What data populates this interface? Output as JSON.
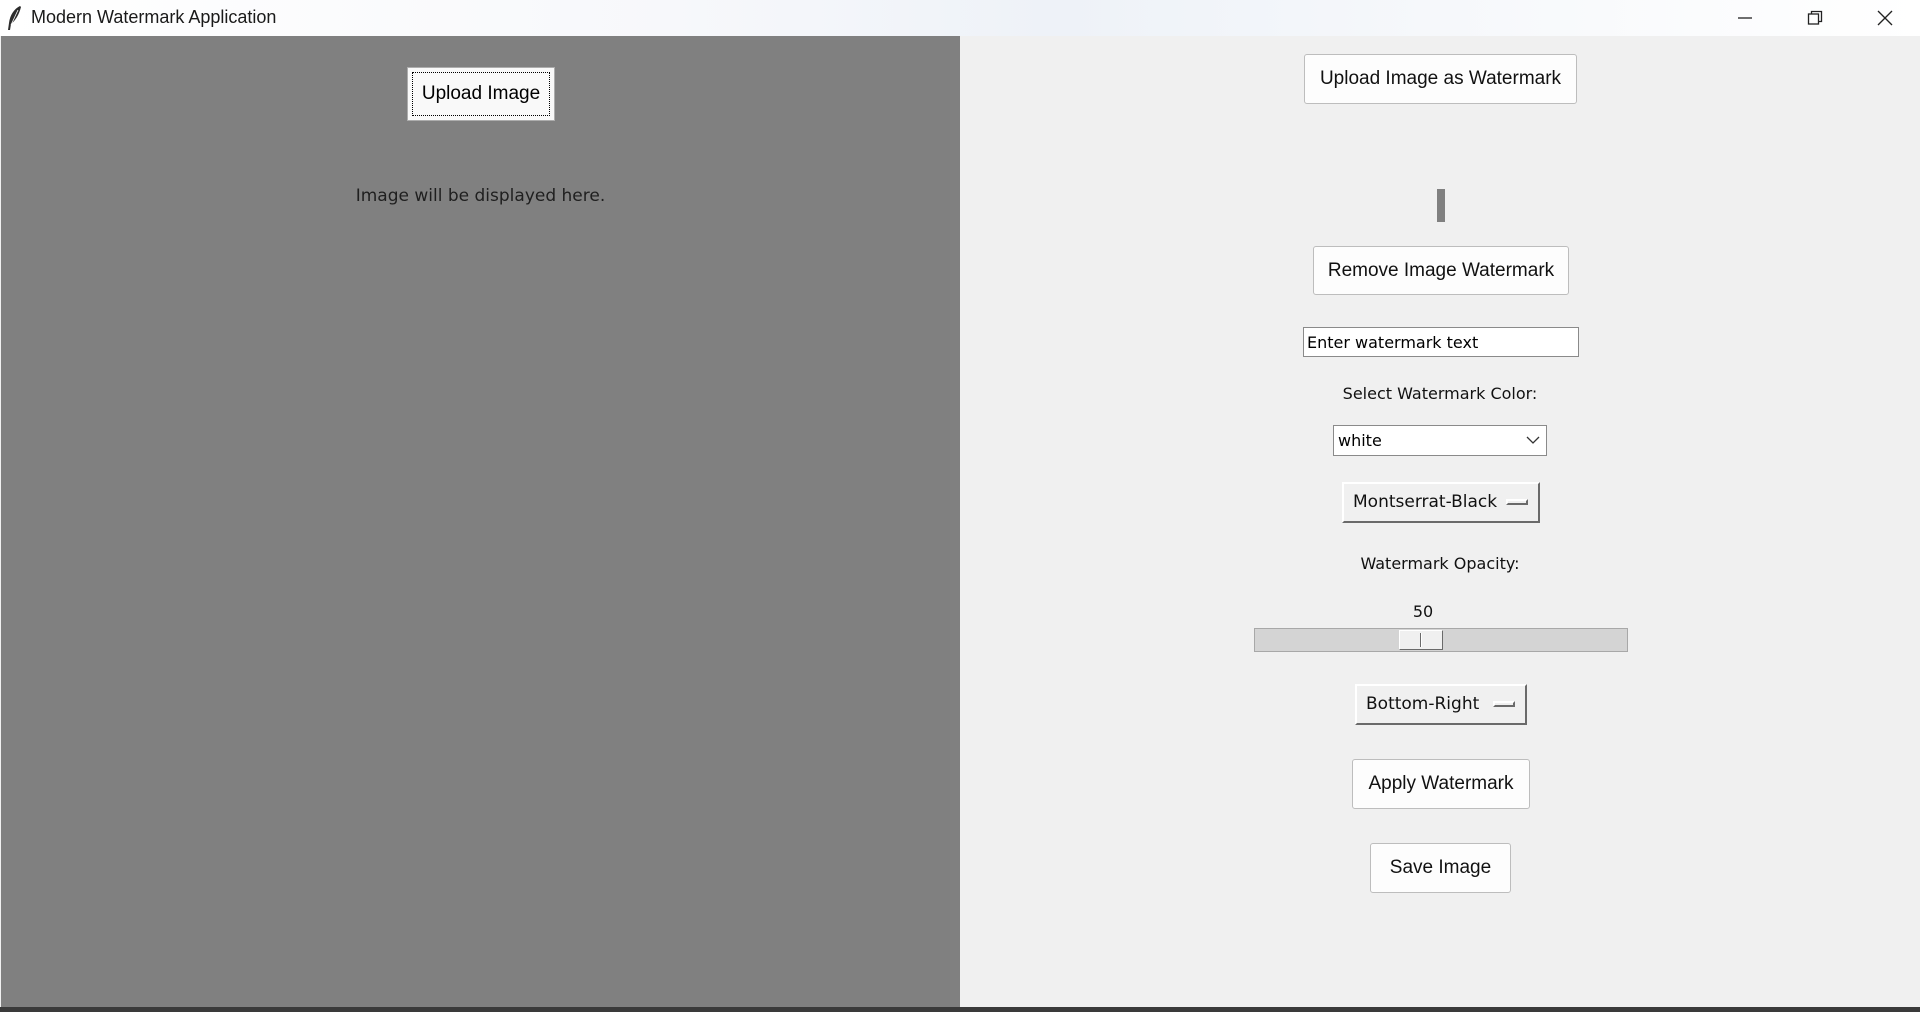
{
  "window": {
    "title": "Modern Watermark Application",
    "controls": [
      "minimize-icon",
      "restore-icon",
      "close-icon"
    ]
  },
  "left_panel": {
    "background": "#808080",
    "upload_button_label": "Upload Image",
    "placeholder_text": "Image will be displayed here."
  },
  "right_panel": {
    "upload_watermark_label": "Upload Image as Watermark",
    "remove_watermark_label": "Remove Image Watermark",
    "watermark_text_input": {
      "value": "Enter watermark text"
    },
    "color_label": "Select Watermark Color:",
    "color_select": {
      "selected": "white"
    },
    "font_menu": {
      "selected": "Montserrat-Black"
    },
    "opacity_label": "Watermark Opacity:",
    "opacity_scale": {
      "value": "50",
      "fraction": 0.5
    },
    "position_menu": {
      "selected": "Bottom-Right"
    },
    "apply_label": "Apply Watermark",
    "save_label": "Save Image"
  }
}
